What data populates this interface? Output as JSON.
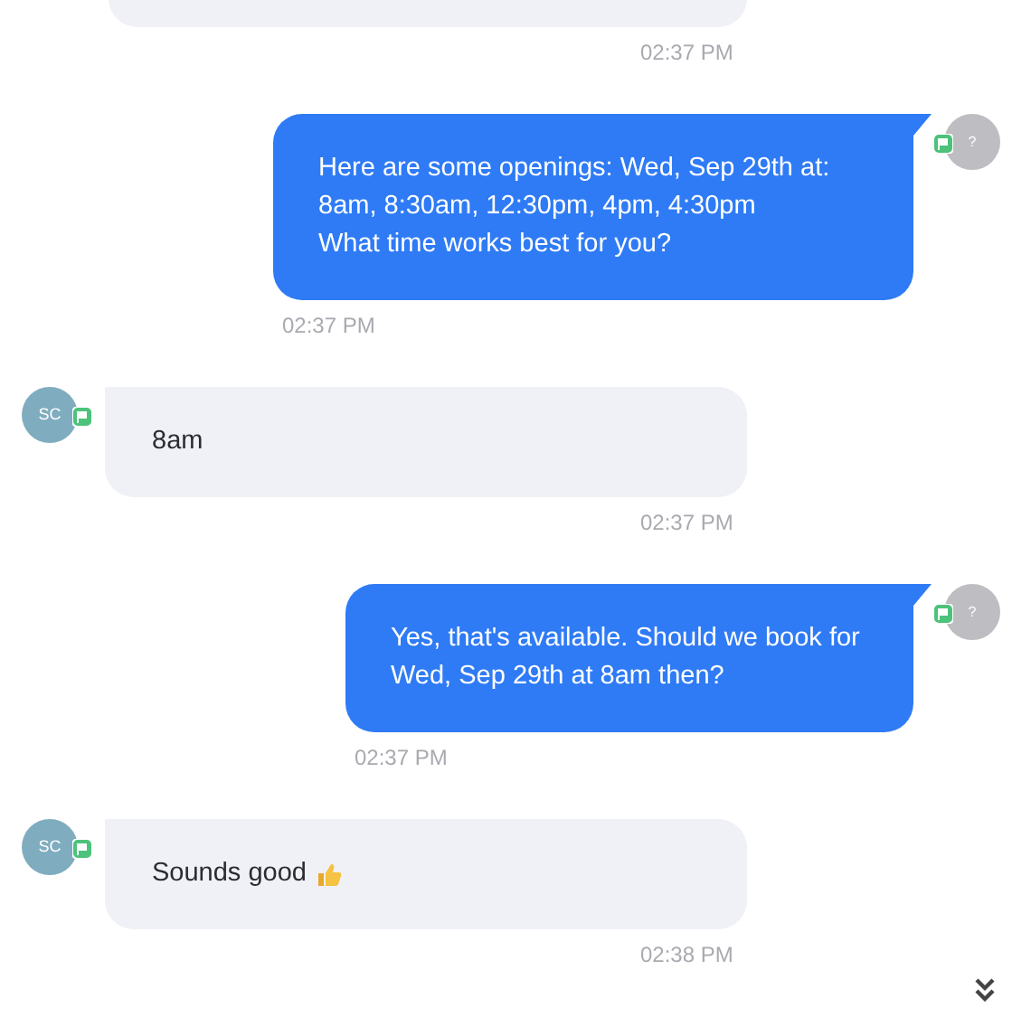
{
  "messages": [
    {
      "kind": "incoming",
      "cut_off": true,
      "time": "02:37 PM"
    },
    {
      "kind": "outgoing",
      "avatar": "?",
      "lines": [
        "Here are some openings: Wed, Sep 29th at:",
        "8am, 8:30am, 12:30pm, 4pm, 4:30pm",
        "What time works best for you?"
      ],
      "time": "02:37 PM"
    },
    {
      "kind": "incoming",
      "avatar": "SC",
      "lines": [
        "8am"
      ],
      "time": "02:37 PM"
    },
    {
      "kind": "outgoing",
      "avatar": "?",
      "lines": [
        "Yes, that's available. Should we book for",
        "Wed, Sep 29th at 8am then?"
      ],
      "time": "02:37 PM"
    },
    {
      "kind": "incoming",
      "avatar": "SC",
      "lines": [
        "Sounds good"
      ],
      "thumbs_up": true,
      "time": "02:38 PM"
    }
  ],
  "scroll_to_bottom": true
}
